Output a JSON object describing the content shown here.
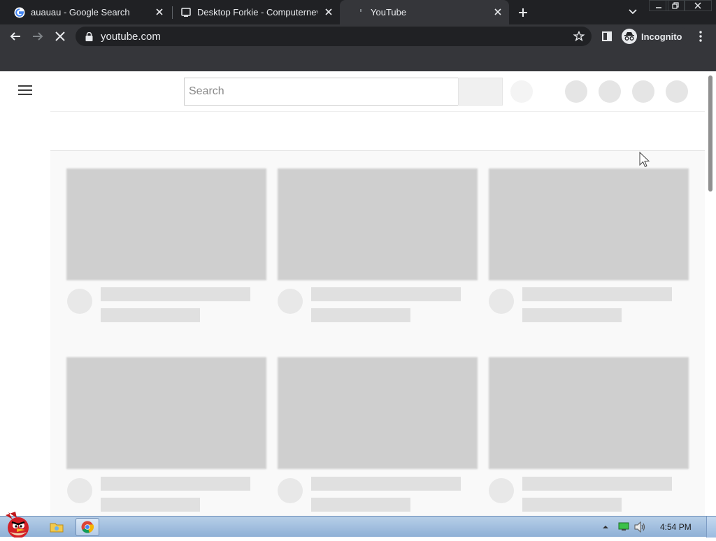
{
  "browser": {
    "tabs": [
      {
        "title": "auauau - Google Search",
        "icon": "google-icon",
        "active": false
      },
      {
        "title": "Desktop Forkie - Computernew",
        "icon": "computernewb-icon",
        "active": false
      },
      {
        "title": "YouTube",
        "icon": "loading-icon",
        "active": true
      }
    ],
    "url": "youtube.com",
    "profile_label": "Incognito"
  },
  "youtube": {
    "search_placeholder": "Search"
  },
  "taskbar": {
    "clock": "4:54 PM"
  },
  "colors": {
    "chrome_dark": "#202124",
    "toolbar": "#35363a",
    "skeleton": "#cfcfcf"
  }
}
